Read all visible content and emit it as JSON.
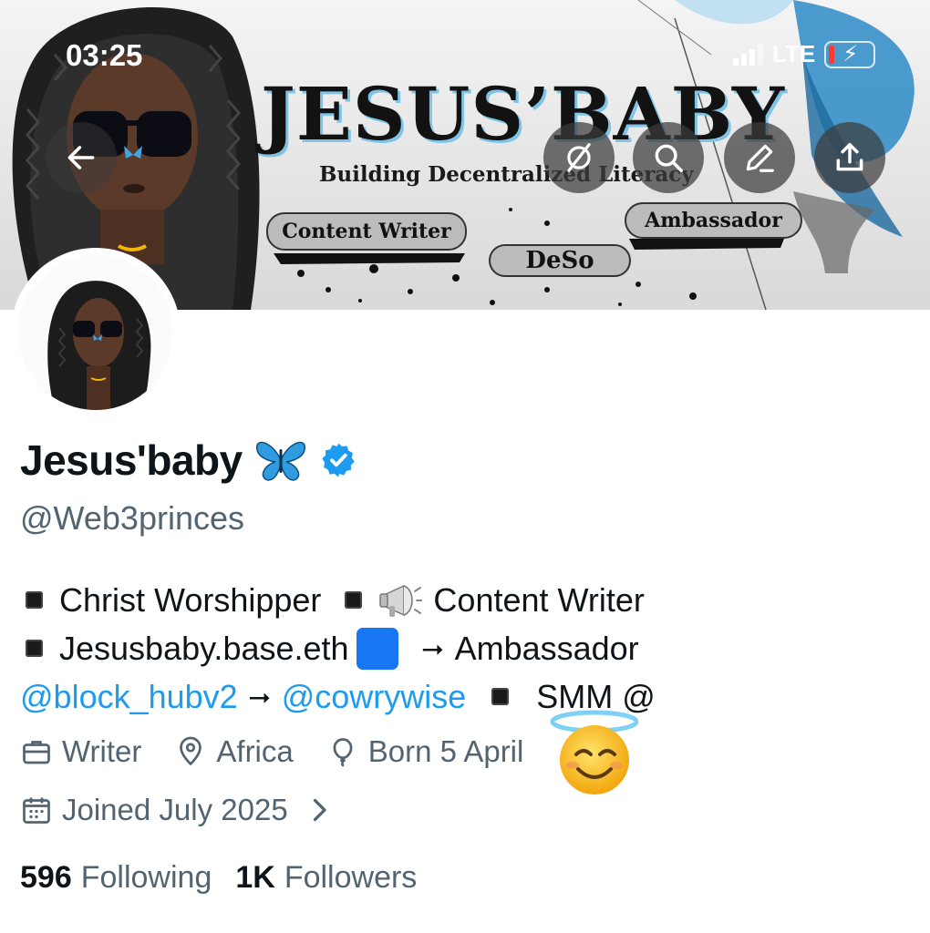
{
  "status_bar": {
    "time": "03:25",
    "network": "LTE"
  },
  "banner": {
    "title": "JESUS’BABY",
    "subtitle": "Building Decentralized Literacy",
    "tags": [
      "Content Writer",
      "DeSo",
      "Ambassador"
    ],
    "watermark": "JesusBaby",
    "accent_color": "#7fc4e6"
  },
  "header_actions": [
    "back-icon",
    "grok-icon",
    "search-icon",
    "edit-icon",
    "share-icon"
  ],
  "profile": {
    "display_name": "Jesus'baby",
    "handle": "@Web3princes",
    "verified": true,
    "verified_color": "#1d9bf0"
  },
  "bio": {
    "line1": {
      "a": "Christ Worshipper",
      "b": "Content Writer"
    },
    "line2": {
      "a": "Jesusbaby.base.eth",
      "arrow": "⭢",
      "b": "Ambassador"
    },
    "line3": {
      "mention1": "@block_hubv2",
      "arrow": "⭢",
      "mention2": "@cowrywise",
      "tail": "SMM @"
    }
  },
  "meta": {
    "profession": "Writer",
    "location": "Africa",
    "birthday": "Born 5 April",
    "joined": "Joined July 2025"
  },
  "stats": {
    "following_count": "596",
    "following_label": "Following",
    "followers_count": "1K",
    "followers_label": "Followers"
  },
  "colors": {
    "link": "#1d9bf0",
    "secondary_text": "#536471",
    "primary_text": "#0f1419"
  }
}
